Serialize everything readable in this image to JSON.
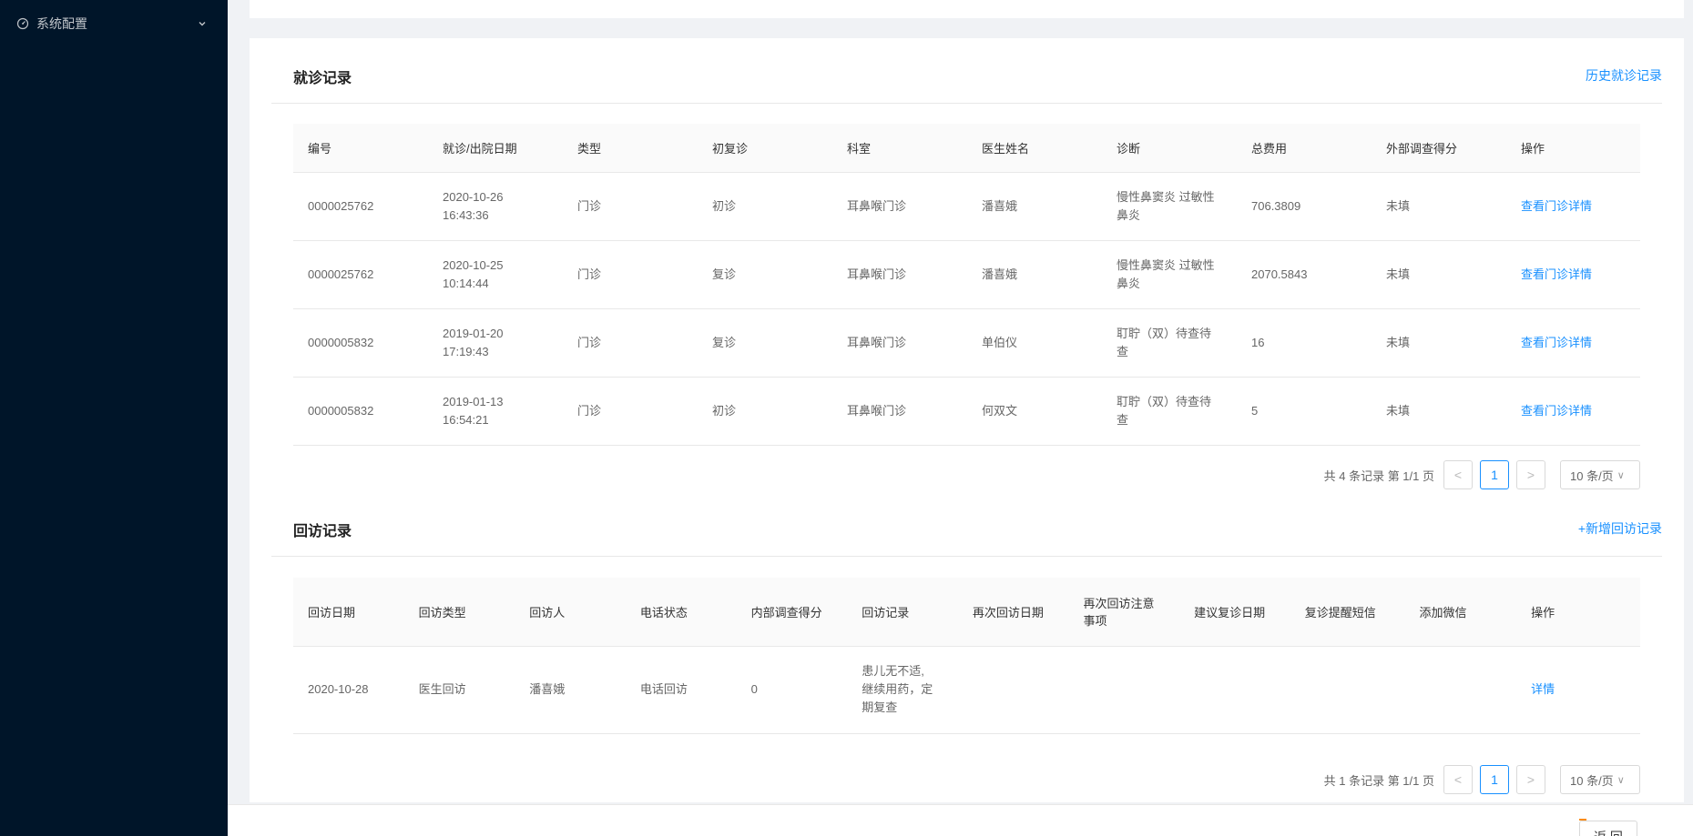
{
  "sidebar": {
    "items": [
      {
        "label": "系统配置",
        "icon": "dashboard-icon"
      }
    ]
  },
  "visits": {
    "title": "就诊记录",
    "history_link": "历史就诊记录",
    "columns": [
      "编号",
      "就诊/出院日期",
      "类型",
      "初复诊",
      "科室",
      "医生姓名",
      "诊断",
      "总费用",
      "外部调查得分",
      "操作"
    ],
    "rows": [
      {
        "id": "0000025762",
        "date": "2020-10-26",
        "time": "16:43:36",
        "type": "门诊",
        "visit": "初诊",
        "dept": "耳鼻喉门诊",
        "doctor": "潘喜娥",
        "diag1": "慢性鼻窦炎 过敏性",
        "diag2": "鼻炎",
        "fee": "706.3809",
        "score": "未填",
        "action": "查看门诊详情"
      },
      {
        "id": "0000025762",
        "date": "2020-10-25",
        "time": "10:14:44",
        "type": "门诊",
        "visit": "复诊",
        "dept": "耳鼻喉门诊",
        "doctor": "潘喜娥",
        "diag1": "慢性鼻窦炎 过敏性",
        "diag2": "鼻炎",
        "fee": "2070.5843",
        "score": "未填",
        "action": "查看门诊详情"
      },
      {
        "id": "0000005832",
        "date": "2019-01-20",
        "time": "17:19:43",
        "type": "门诊",
        "visit": "复诊",
        "dept": "耳鼻喉门诊",
        "doctor": "单伯仪",
        "diag1": "耵聍（双）待查待",
        "diag2": "查",
        "fee": "16",
        "score": "未填",
        "action": "查看门诊详情"
      },
      {
        "id": "0000005832",
        "date": "2019-01-13",
        "time": "16:54:21",
        "type": "门诊",
        "visit": "初诊",
        "dept": "耳鼻喉门诊",
        "doctor": "何双文",
        "diag1": "耵聍（双）待查待",
        "diag2": "查",
        "fee": "5",
        "score": "未填",
        "action": "查看门诊详情"
      }
    ],
    "pager": {
      "total_text": "共 4 条记录 第 1/1 页",
      "prev": "<",
      "page": "1",
      "next": ">",
      "size": "10 条/页",
      "size_arrow": "∨"
    }
  },
  "followups": {
    "title": "回访记录",
    "add_link": "+新增回访记录",
    "columns": [
      "回访日期",
      "回访类型",
      "回访人",
      "电话状态",
      "内部调查得分",
      "回访记录",
      "再次回访日期",
      "再次回访注意事项",
      "建议复诊日期",
      "复诊提醒短信",
      "添加微信",
      "操作"
    ],
    "col_note_line1": "再次回访注意",
    "col_note_line2": "事项",
    "rows": [
      {
        "date": "2020-10-28",
        "type": "医生回访",
        "person": "潘喜娥",
        "phone": "电话回访",
        "score": "0",
        "rec1": "患儿无不适,",
        "rec2": "继续用药，定",
        "rec3": "期复查",
        "next": "",
        "notes": "",
        "revisit": "",
        "sms": "",
        "wechat": "",
        "action": "详情"
      }
    ],
    "pager": {
      "total_text": "共 1 条记录 第 1/1 页",
      "prev": "<",
      "page": "1",
      "next": ">",
      "size": "10 条/页",
      "size_arrow": "∨"
    }
  },
  "footer": {
    "back_label": "返 回"
  }
}
